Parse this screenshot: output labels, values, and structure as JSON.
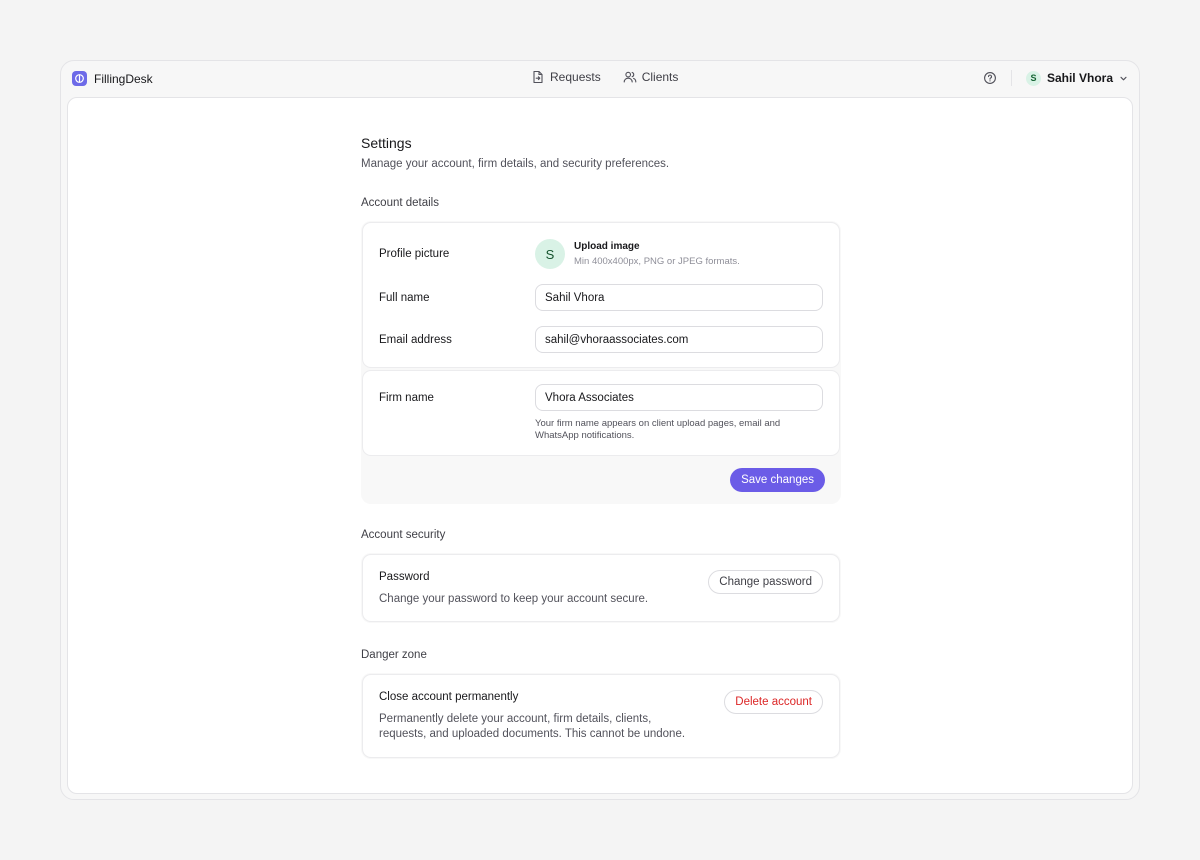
{
  "app": {
    "name": "FillingDesk"
  },
  "nav": {
    "items": [
      {
        "label": "Requests",
        "icon": "file-upload-icon"
      },
      {
        "label": "Clients",
        "icon": "users-icon"
      }
    ]
  },
  "user": {
    "initial": "S",
    "name": "Sahil Vhora"
  },
  "page": {
    "title": "Settings",
    "subtitle": "Manage your account, firm details, and security preferences."
  },
  "account_details": {
    "section_title": "Account details",
    "profile_picture_label": "Profile picture",
    "avatar_initial": "S",
    "upload_title": "Upload image",
    "upload_hint": "Min 400x400px, PNG or JPEG formats.",
    "full_name_label": "Full name",
    "full_name_value": "Sahil Vhora",
    "email_label": "Email address",
    "email_value": "sahil@vhoraassociates.com",
    "firm_name_label": "Firm name",
    "firm_name_value": "Vhora Associates",
    "firm_help_text": "Your firm name appears on client upload pages, email and WhatsApp notifications.",
    "save_label": "Save changes"
  },
  "security": {
    "section_title": "Account security",
    "password_title": "Password",
    "password_desc": "Change your password to keep your account secure.",
    "change_password_label": "Change password"
  },
  "danger": {
    "section_title": "Danger zone",
    "close_title": "Close account permanently",
    "close_desc": "Permanently delete your account, firm details, clients, requests, and uploaded documents. This cannot be undone.",
    "delete_label": "Delete account"
  },
  "colors": {
    "accent": "#6b5ce7",
    "danger": "#dc2626",
    "avatar_bg": "#d9f2e6"
  }
}
